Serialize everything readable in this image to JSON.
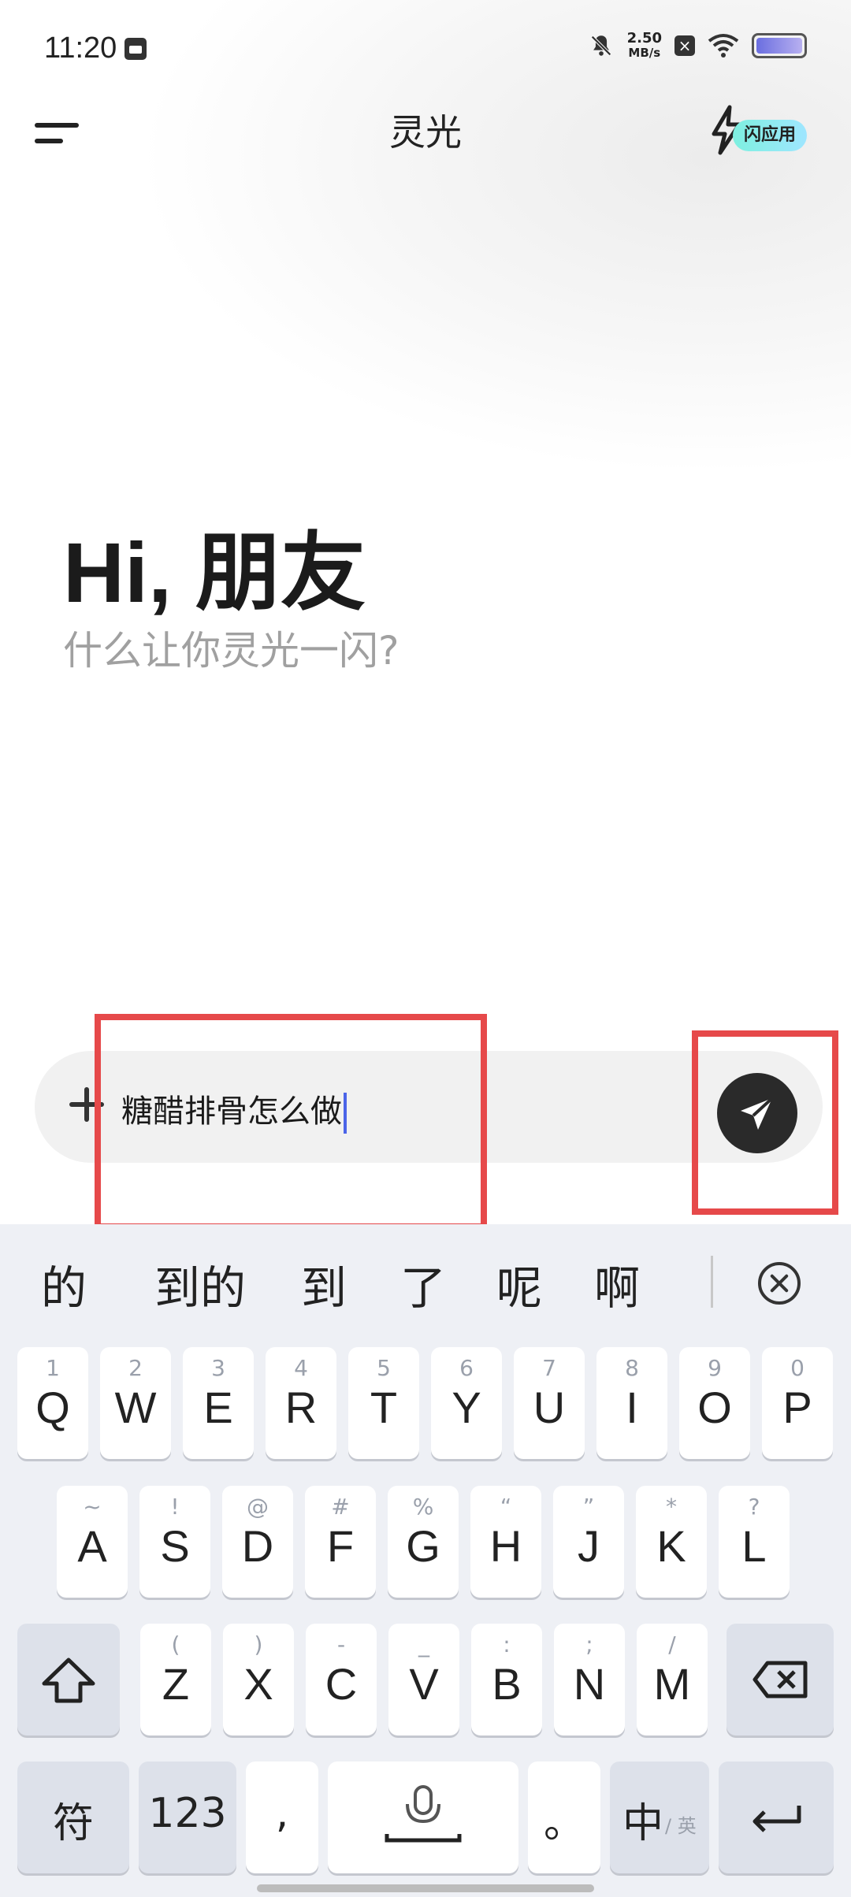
{
  "status_bar": {
    "time": "11:20",
    "net_speed_value": "2.50",
    "net_speed_unit": "MB/s"
  },
  "header": {
    "title": "灵光",
    "flash_app_label": "闪应用"
  },
  "greeting": {
    "title": "Hi, 朋友",
    "subtitle": "什么让你灵光一闪?"
  },
  "input": {
    "value": "糖醋排骨怎么做"
  },
  "keyboard": {
    "candidates": [
      "的",
      "到的",
      "到",
      "了",
      "呢",
      "啊"
    ],
    "row1": [
      {
        "k": "Q",
        "s": "1"
      },
      {
        "k": "W",
        "s": "2"
      },
      {
        "k": "E",
        "s": "3"
      },
      {
        "k": "R",
        "s": "4"
      },
      {
        "k": "T",
        "s": "5"
      },
      {
        "k": "Y",
        "s": "6"
      },
      {
        "k": "U",
        "s": "7"
      },
      {
        "k": "I",
        "s": "8"
      },
      {
        "k": "O",
        "s": "9"
      },
      {
        "k": "P",
        "s": "0"
      }
    ],
    "row2": [
      {
        "k": "A",
        "s": "~"
      },
      {
        "k": "S",
        "s": "!"
      },
      {
        "k": "D",
        "s": "@"
      },
      {
        "k": "F",
        "s": "#"
      },
      {
        "k": "G",
        "s": "%"
      },
      {
        "k": "H",
        "s": "“"
      },
      {
        "k": "J",
        "s": "”"
      },
      {
        "k": "K",
        "s": "*"
      },
      {
        "k": "L",
        "s": "?"
      }
    ],
    "row3": [
      {
        "k": "Z",
        "s": "("
      },
      {
        "k": "X",
        "s": ")"
      },
      {
        "k": "C",
        "s": "-"
      },
      {
        "k": "V",
        "s": "_"
      },
      {
        "k": "B",
        "s": ":"
      },
      {
        "k": "N",
        "s": ";"
      },
      {
        "k": "M",
        "s": "/"
      }
    ],
    "symbols_label": "符",
    "numbers_label": "123",
    "comma_label": ",",
    "period_label": "。",
    "lang_label": "中",
    "lang_alt_label": "/ 英"
  },
  "colors": {
    "highlight": "#e6494a",
    "caret": "#4b64e8",
    "send_button": "#2a2a2a"
  }
}
